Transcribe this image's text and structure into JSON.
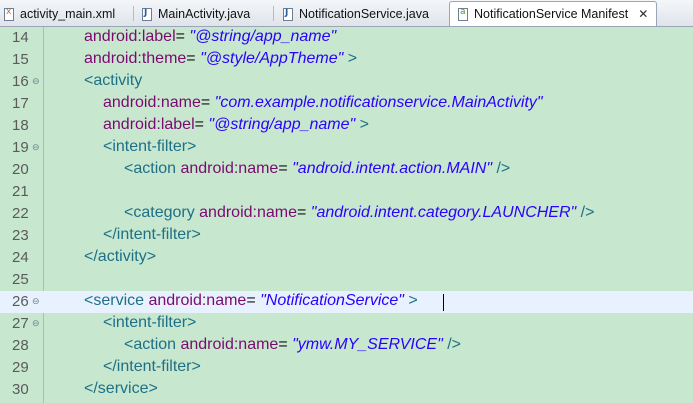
{
  "tabs": [
    {
      "label": "activity_main.xml",
      "icon": "xml-file-icon",
      "active": false
    },
    {
      "label": "MainActivity.java",
      "icon": "java-file-icon",
      "active": false
    },
    {
      "label": "NotificationService.java",
      "icon": "java-file-icon",
      "active": false
    },
    {
      "label": "NotificationService Manifest",
      "icon": "manifest-file-icon",
      "active": true
    }
  ],
  "close_glyph": "✕",
  "lines": [
    {
      "num": "14",
      "fold": "",
      "tokens": [
        [
          "kw",
          "android:label"
        ],
        [
          "eq",
          "= "
        ],
        [
          "st",
          "\"@string/app_name\""
        ]
      ]
    },
    {
      "num": "15",
      "fold": "",
      "tokens": [
        [
          "kw",
          "android:theme"
        ],
        [
          "eq",
          "= "
        ],
        [
          "st",
          "\"@style/AppTheme\""
        ],
        [
          "tg",
          " >"
        ]
      ]
    },
    {
      "num": "16",
      "fold": "⊖",
      "tokens": [
        [
          "tg",
          "<activity"
        ]
      ]
    },
    {
      "num": "17",
      "fold": "",
      "tokens": [
        [
          "kw",
          "android:name"
        ],
        [
          "eq",
          "= "
        ],
        [
          "st",
          "\"com.example.notificationservice.MainActivity\""
        ]
      ]
    },
    {
      "num": "18",
      "fold": "",
      "tokens": [
        [
          "kw",
          "android:label"
        ],
        [
          "eq",
          "= "
        ],
        [
          "st",
          "\"@string/app_name\""
        ],
        [
          "tg",
          " >"
        ]
      ]
    },
    {
      "num": "19",
      "fold": "⊖",
      "tokens": [
        [
          "tg",
          "<intent-filter>"
        ]
      ]
    },
    {
      "num": "20",
      "fold": "",
      "tokens": [
        [
          "tg",
          "<action "
        ],
        [
          "kw",
          "android:name"
        ],
        [
          "eq",
          "= "
        ],
        [
          "st",
          "\"android.intent.action.MAIN\""
        ],
        [
          "tg",
          " />"
        ]
      ]
    },
    {
      "num": "21",
      "fold": "",
      "tokens": []
    },
    {
      "num": "22",
      "fold": "",
      "tokens": [
        [
          "tg",
          "<category "
        ],
        [
          "kw",
          "android:name"
        ],
        [
          "eq",
          "= "
        ],
        [
          "st",
          "\"android.intent.category.LAUNCHER\""
        ],
        [
          "tg",
          " />"
        ]
      ]
    },
    {
      "num": "23",
      "fold": "",
      "tokens": [
        [
          "tg",
          "</intent-filter>"
        ]
      ]
    },
    {
      "num": "24",
      "fold": "",
      "tokens": [
        [
          "tg",
          "</activity>"
        ]
      ]
    },
    {
      "num": "25",
      "fold": "",
      "tokens": []
    },
    {
      "num": "26",
      "fold": "⊖",
      "tokens": [
        [
          "tg",
          "<service "
        ],
        [
          "kw",
          "android:name"
        ],
        [
          "eq",
          "= "
        ],
        [
          "st",
          "\"NotificationService\""
        ],
        [
          "tg",
          " >"
        ]
      ]
    },
    {
      "num": "27",
      "fold": "⊖",
      "tokens": [
        [
          "tg",
          "<intent-filter>"
        ]
      ]
    },
    {
      "num": "28",
      "fold": "",
      "tokens": [
        [
          "tg",
          "<action "
        ],
        [
          "kw",
          "android:name"
        ],
        [
          "eq",
          "= "
        ],
        [
          "st",
          "\"ymw.MY_SERVICE\""
        ],
        [
          "tg",
          " />"
        ]
      ]
    },
    {
      "num": "29",
      "fold": "",
      "tokens": [
        [
          "tg",
          "</intent-filter>"
        ]
      ]
    },
    {
      "num": "30",
      "fold": "",
      "tokens": [
        [
          "tg",
          "</service>"
        ]
      ]
    }
  ],
  "current_line": "26",
  "colors": {
    "keyword": "#7b0a6f",
    "tag": "#1f6f86",
    "string": "#2a00ff",
    "background": "#c7e8cf",
    "current_line": "#e8f2fe"
  }
}
